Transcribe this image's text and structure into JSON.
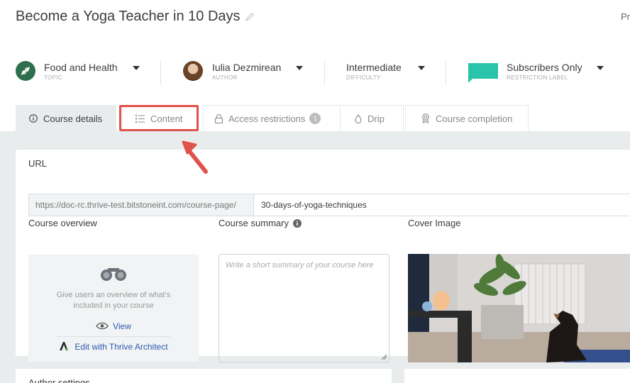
{
  "header": {
    "title": "Become a Yoga Teacher in 10 Days",
    "top_right": "Pr"
  },
  "meta": [
    {
      "value": "Food and Health",
      "sub": "TOPIC"
    },
    {
      "value": "Iulia Dezmirean",
      "sub": "AUTHOR"
    },
    {
      "value": "Intermediate",
      "sub": "DIFFICULTY"
    },
    {
      "value": "Subscribers Only",
      "sub": "RESTRICTION LABEL"
    }
  ],
  "colors": {
    "topic": "#2e6e4c",
    "restriction": "#2ac4ab",
    "highlight": "#e0524a",
    "link": "#2c5baf"
  },
  "tabs": [
    {
      "label": "Course details",
      "icon": "info-icon",
      "active": true
    },
    {
      "label": "Content",
      "icon": "list-icon",
      "active": false
    },
    {
      "label": "Access restrictions",
      "icon": "lock-icon",
      "badge": "1",
      "active": false
    },
    {
      "label": "Drip",
      "icon": "drop-icon",
      "active": false
    },
    {
      "label": "Course completion",
      "icon": "award-icon",
      "active": false
    }
  ],
  "url": {
    "label": "URL",
    "prefix": "https://doc-rc.thrive-test.bitstoneint.com/course-page/",
    "slug": "30-days-of-yoga-techniques"
  },
  "overview": {
    "label": "Course overview",
    "text_line1": "Give users an overview of what's",
    "text_line2": "included in your course",
    "view": "View",
    "edit": "Edit with Thrive Architect"
  },
  "summary": {
    "label": "Course summary",
    "placeholder": "Write a short summary of your course here"
  },
  "cover": {
    "label": "Cover Image"
  },
  "author_settings": {
    "label": "Author settings"
  }
}
